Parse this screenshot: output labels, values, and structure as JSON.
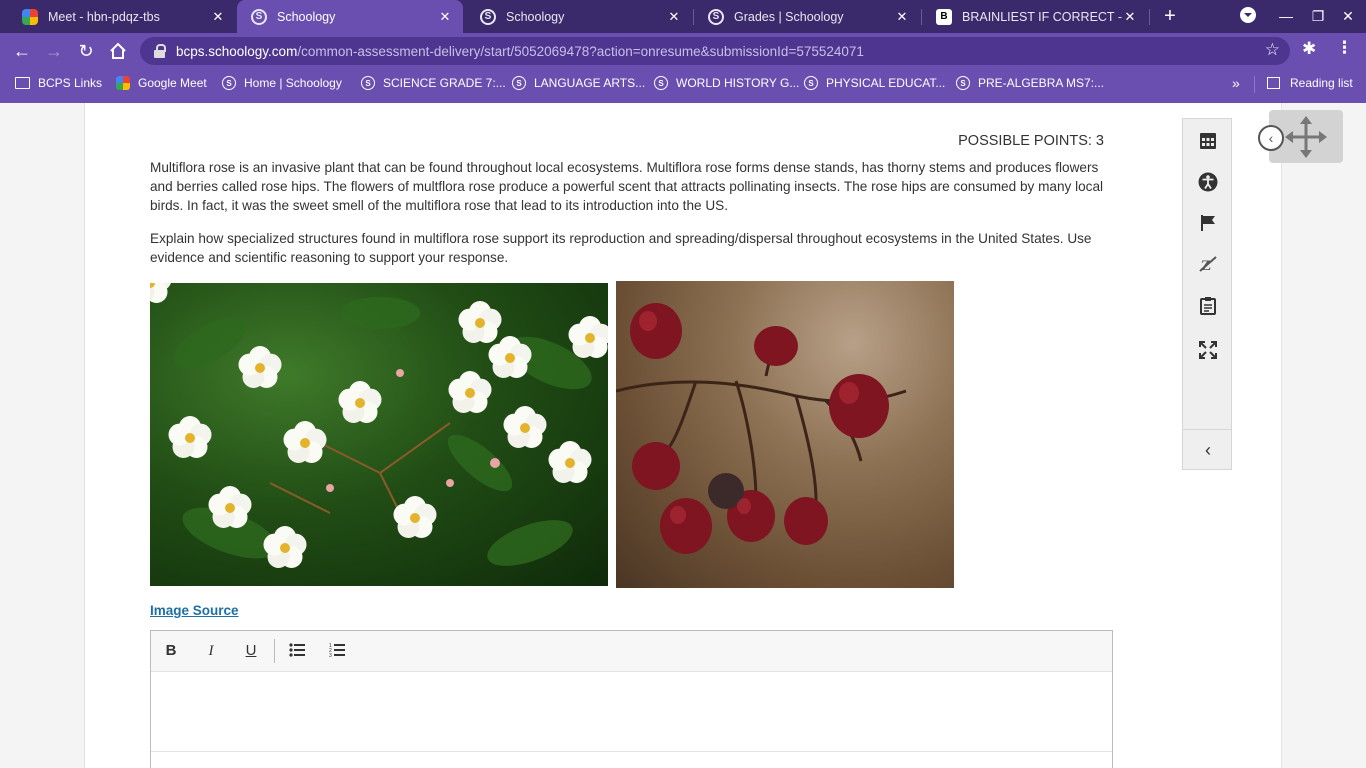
{
  "browser": {
    "tabs": [
      {
        "title": "Meet - hbn-pdqz-tbs",
        "favicon": "meet-icon",
        "active": false
      },
      {
        "title": "Schoology",
        "favicon": "schoology-icon",
        "active": true
      },
      {
        "title": "Schoology",
        "favicon": "schoology-icon",
        "active": false
      },
      {
        "title": "Grades | Schoology",
        "favicon": "schoology-icon",
        "active": false
      },
      {
        "title": "BRAINLIEST IF CORRECT - Brai",
        "favicon": "brainly-icon",
        "active": false
      }
    ],
    "url_host": "bcps.schoology.com",
    "url_path": "/common-assessment-delivery/start/5052069478?action=onresume&submissionId=575524071",
    "bookmarks": [
      {
        "label": "BCPS Links",
        "icon": "folder-icon"
      },
      {
        "label": "Google Meet",
        "icon": "meet-icon"
      },
      {
        "label": "Home | Schoology",
        "icon": "schoology-icon"
      },
      {
        "label": "SCIENCE GRADE 7:...",
        "icon": "schoology-icon"
      },
      {
        "label": "LANGUAGE ARTS...",
        "icon": "schoology-icon"
      },
      {
        "label": "WORLD HISTORY G...",
        "icon": "schoology-icon"
      },
      {
        "label": "PHYSICAL EDUCAT...",
        "icon": "schoology-icon"
      },
      {
        "label": "PRE-ALGEBRA MS7:...",
        "icon": "schoology-icon"
      }
    ],
    "reading_list": "Reading list",
    "colors": {
      "tabbar": "#3b2a6b",
      "toolbar": "#6a4fb0",
      "omnibox": "#4e3690"
    }
  },
  "question": {
    "possible_points": "POSSIBLE POINTS: 3",
    "paragraph1": "Multiflora rose is an invasive plant that can be found throughout local ecosystems.  Multiflora rose forms dense stands, has thorny stems and produces flowers and berries called rose hips.  The flowers of multflora rose produce a powerful scent that attracts pollinating insects.  The rose hips are consumed by many local birds.  In fact, it was the sweet smell of the multiflora rose that lead to its introduction into the US.",
    "paragraph2": "Explain how specialized structures found in multiflora rose support its reproduction and spreading/dispersal throughout ecosystems in the United States. Use evidence and scientific reasoning to support your response.",
    "image_source_link": "Image Source",
    "images": [
      "multiflora-rose-flowers-photo",
      "rose-hips-berries-photo"
    ]
  },
  "editor": {
    "toolbar": [
      "bold-icon",
      "italic-icon",
      "underline-icon",
      "bullet-list-icon",
      "numbered-list-icon"
    ],
    "bold": "B",
    "italic": "I",
    "underline": "U",
    "body": ""
  },
  "tool_rail": [
    "calculator-icon",
    "accessibility-icon",
    "flag-icon",
    "eliminate-answer-icon",
    "notepad-icon",
    "fullscreen-icon",
    "chevron-left-icon"
  ]
}
